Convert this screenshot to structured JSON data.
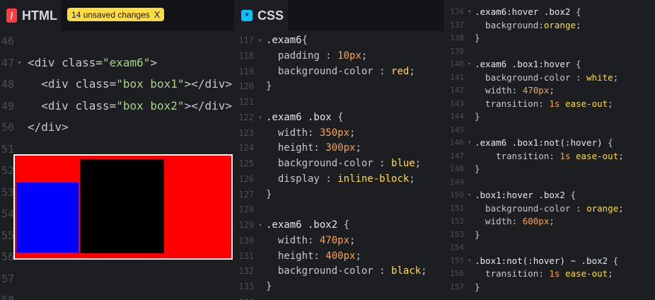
{
  "html_panel": {
    "title": "HTML",
    "badge": "/",
    "unsaved": "14 unsaved changes",
    "unsaved_close": "X",
    "lines": [
      {
        "num": "46",
        "fold": "",
        "tokens": []
      },
      {
        "num": "47",
        "fold": "▾",
        "tokens": [
          {
            "t": "<div ",
            "c": "t-tag"
          },
          {
            "t": "class=",
            "c": "t-attr"
          },
          {
            "t": "\"exam6\"",
            "c": "t-str"
          },
          {
            "t": ">",
            "c": "t-tag"
          }
        ]
      },
      {
        "num": "48",
        "fold": "",
        "tokens": [
          {
            "t": "  <div ",
            "c": "t-tag"
          },
          {
            "t": "class=",
            "c": "t-attr"
          },
          {
            "t": "\"box box1\"",
            "c": "t-str"
          },
          {
            "t": "></div>",
            "c": "t-tag"
          }
        ]
      },
      {
        "num": "49",
        "fold": "",
        "tokens": [
          {
            "t": "  <div ",
            "c": "t-tag"
          },
          {
            "t": "class=",
            "c": "t-attr"
          },
          {
            "t": "\"box box2\"",
            "c": "t-str"
          },
          {
            "t": "></div>",
            "c": "t-tag"
          }
        ]
      },
      {
        "num": "50",
        "fold": "",
        "tokens": [
          {
            "t": "</div>",
            "c": "t-tag"
          }
        ]
      },
      {
        "num": "51",
        "fold": "",
        "tokens": []
      },
      {
        "num": "52",
        "fold": "",
        "tokens": []
      },
      {
        "num": "53",
        "fold": "",
        "tokens": []
      },
      {
        "num": "54",
        "fold": "",
        "tokens": []
      },
      {
        "num": "55",
        "fold": "",
        "tokens": []
      },
      {
        "num": "56",
        "fold": "",
        "tokens": []
      },
      {
        "num": "57",
        "fold": "",
        "tokens": []
      },
      {
        "num": "58",
        "fold": "",
        "tokens": []
      }
    ],
    "preview": {
      "container_color": "#ff0000",
      "box1_color": "#0000ff",
      "box2_color": "#000000"
    }
  },
  "css_panel": {
    "title": "CSS",
    "badge": "*",
    "lines": [
      {
        "num": "117",
        "fold": "▾",
        "tokens": [
          {
            "t": ".exam6",
            "c": "t-sel"
          },
          {
            "t": "{",
            "c": "t-punct"
          }
        ]
      },
      {
        "num": "118",
        "fold": "",
        "tokens": [
          {
            "t": "  padding ",
            "c": "t-prop"
          },
          {
            "t": ": ",
            "c": "t-punct"
          },
          {
            "t": "10px",
            "c": "t-num"
          },
          {
            "t": ";",
            "c": "t-punct"
          }
        ]
      },
      {
        "num": "119",
        "fold": "",
        "tokens": [
          {
            "t": "  background-color ",
            "c": "t-prop"
          },
          {
            "t": ": ",
            "c": "t-punct"
          },
          {
            "t": "red",
            "c": "t-val"
          },
          {
            "t": ";",
            "c": "t-punct"
          }
        ]
      },
      {
        "num": "120",
        "fold": "",
        "tokens": [
          {
            "t": "}",
            "c": "t-punct"
          }
        ]
      },
      {
        "num": "121",
        "fold": "",
        "tokens": []
      },
      {
        "num": "122",
        "fold": "▾",
        "tokens": [
          {
            "t": ".exam6 .box ",
            "c": "t-sel"
          },
          {
            "t": "{",
            "c": "t-punct"
          }
        ]
      },
      {
        "num": "123",
        "fold": "",
        "tokens": [
          {
            "t": "  width: ",
            "c": "t-prop"
          },
          {
            "t": "350px",
            "c": "t-num"
          },
          {
            "t": ";",
            "c": "t-punct"
          }
        ]
      },
      {
        "num": "124",
        "fold": "",
        "tokens": [
          {
            "t": "  height: ",
            "c": "t-prop"
          },
          {
            "t": "300px",
            "c": "t-num"
          },
          {
            "t": ";",
            "c": "t-punct"
          }
        ]
      },
      {
        "num": "125",
        "fold": "",
        "tokens": [
          {
            "t": "  background-color ",
            "c": "t-prop"
          },
          {
            "t": ": ",
            "c": "t-punct"
          },
          {
            "t": "blue",
            "c": "t-val"
          },
          {
            "t": ";",
            "c": "t-punct"
          }
        ]
      },
      {
        "num": "126",
        "fold": "",
        "tokens": [
          {
            "t": "  display ",
            "c": "t-prop"
          },
          {
            "t": ": ",
            "c": "t-punct"
          },
          {
            "t": "inline-block",
            "c": "t-val"
          },
          {
            "t": ";",
            "c": "t-punct"
          }
        ]
      },
      {
        "num": "127",
        "fold": "",
        "tokens": [
          {
            "t": "}",
            "c": "t-punct"
          }
        ]
      },
      {
        "num": "128",
        "fold": "",
        "tokens": []
      },
      {
        "num": "129",
        "fold": "▾",
        "tokens": [
          {
            "t": ".exam6 .box2 ",
            "c": "t-sel"
          },
          {
            "t": "{",
            "c": "t-punct"
          }
        ]
      },
      {
        "num": "130",
        "fold": "",
        "tokens": [
          {
            "t": "  width: ",
            "c": "t-prop"
          },
          {
            "t": "470px",
            "c": "t-num"
          },
          {
            "t": ";",
            "c": "t-punct"
          }
        ]
      },
      {
        "num": "131",
        "fold": "",
        "tokens": [
          {
            "t": "  height: ",
            "c": "t-prop"
          },
          {
            "t": "400px",
            "c": "t-num"
          },
          {
            "t": ";",
            "c": "t-punct"
          }
        ]
      },
      {
        "num": "132",
        "fold": "",
        "tokens": [
          {
            "t": "  background-color ",
            "c": "t-prop"
          },
          {
            "t": ": ",
            "c": "t-punct"
          },
          {
            "t": "black",
            "c": "t-val"
          },
          {
            "t": ";",
            "c": "t-punct"
          }
        ]
      },
      {
        "num": "133",
        "fold": "",
        "tokens": [
          {
            "t": "}",
            "c": "t-punct"
          }
        ]
      },
      {
        "num": "134",
        "fold": "",
        "tokens": []
      }
    ]
  },
  "css_panel_right": {
    "lines": [
      {
        "num": "136",
        "fold": "▾",
        "tokens": [
          {
            "t": ".exam6:hover .box2 ",
            "c": "t-sel"
          },
          {
            "t": "{",
            "c": "t-punct"
          }
        ]
      },
      {
        "num": "137",
        "fold": "",
        "tokens": [
          {
            "t": "  background:",
            "c": "t-prop"
          },
          {
            "t": "orange",
            "c": "t-val"
          },
          {
            "t": ";",
            "c": "t-punct"
          }
        ]
      },
      {
        "num": "138",
        "fold": "",
        "tokens": [
          {
            "t": "}",
            "c": "t-punct"
          }
        ]
      },
      {
        "num": "139",
        "fold": "",
        "tokens": []
      },
      {
        "num": "140",
        "fold": "▾",
        "tokens": [
          {
            "t": ".exam6 .box1:hover ",
            "c": "t-sel"
          },
          {
            "t": "{",
            "c": "t-punct"
          }
        ]
      },
      {
        "num": "141",
        "fold": "",
        "tokens": [
          {
            "t": "  background-color ",
            "c": "t-prop"
          },
          {
            "t": ": ",
            "c": "t-punct"
          },
          {
            "t": "white",
            "c": "t-val"
          },
          {
            "t": ";",
            "c": "t-punct"
          }
        ]
      },
      {
        "num": "142",
        "fold": "",
        "tokens": [
          {
            "t": "  width: ",
            "c": "t-prop"
          },
          {
            "t": "470px",
            "c": "t-num"
          },
          {
            "t": ";",
            "c": "t-punct"
          }
        ]
      },
      {
        "num": "143",
        "fold": "",
        "tokens": [
          {
            "t": "  transition: ",
            "c": "t-prop"
          },
          {
            "t": "1s",
            "c": "t-num"
          },
          {
            "t": " ease-out",
            "c": "t-val"
          },
          {
            "t": ";",
            "c": "t-punct"
          }
        ]
      },
      {
        "num": "144",
        "fold": "",
        "tokens": [
          {
            "t": "}",
            "c": "t-punct"
          }
        ]
      },
      {
        "num": "145",
        "fold": "",
        "tokens": []
      },
      {
        "num": "146",
        "fold": "▾",
        "tokens": [
          {
            "t": ".exam6 .box1:not(:hover) ",
            "c": "t-sel"
          },
          {
            "t": "{",
            "c": "t-punct"
          }
        ]
      },
      {
        "num": "147",
        "fold": "",
        "tokens": [
          {
            "t": "    transition: ",
            "c": "t-prop"
          },
          {
            "t": "1s",
            "c": "t-num"
          },
          {
            "t": " ease-out",
            "c": "t-val"
          },
          {
            "t": ";",
            "c": "t-punct"
          }
        ]
      },
      {
        "num": "148",
        "fold": "",
        "tokens": [
          {
            "t": "}",
            "c": "t-punct"
          }
        ]
      },
      {
        "num": "149",
        "fold": "",
        "tokens": []
      },
      {
        "num": "150",
        "fold": "▾",
        "tokens": [
          {
            "t": ".box1:hover .box2 ",
            "c": "t-sel"
          },
          {
            "t": "{",
            "c": "t-punct"
          }
        ]
      },
      {
        "num": "151",
        "fold": "",
        "tokens": [
          {
            "t": "  background-color ",
            "c": "t-prop"
          },
          {
            "t": ": ",
            "c": "t-punct"
          },
          {
            "t": "orange",
            "c": "t-val"
          },
          {
            "t": ";",
            "c": "t-punct"
          }
        ]
      },
      {
        "num": "152",
        "fold": "",
        "tokens": [
          {
            "t": "  width: ",
            "c": "t-prop"
          },
          {
            "t": "600px",
            "c": "t-num"
          },
          {
            "t": ";",
            "c": "t-punct"
          }
        ]
      },
      {
        "num": "153",
        "fold": "",
        "tokens": [
          {
            "t": "}",
            "c": "t-punct"
          }
        ]
      },
      {
        "num": "154",
        "fold": "",
        "tokens": []
      },
      {
        "num": "155",
        "fold": "▾",
        "tokens": [
          {
            "t": ".box1:not(:hover) ~ .box2 ",
            "c": "t-sel"
          },
          {
            "t": "{",
            "c": "t-punct"
          }
        ]
      },
      {
        "num": "156",
        "fold": "",
        "tokens": [
          {
            "t": "  transition: ",
            "c": "t-prop"
          },
          {
            "t": "1s",
            "c": "t-num"
          },
          {
            "t": " ease-out",
            "c": "t-val"
          },
          {
            "t": ";",
            "c": "t-punct"
          }
        ]
      },
      {
        "num": "157",
        "fold": "",
        "tokens": [
          {
            "t": "}",
            "c": "t-punct"
          }
        ]
      }
    ]
  }
}
